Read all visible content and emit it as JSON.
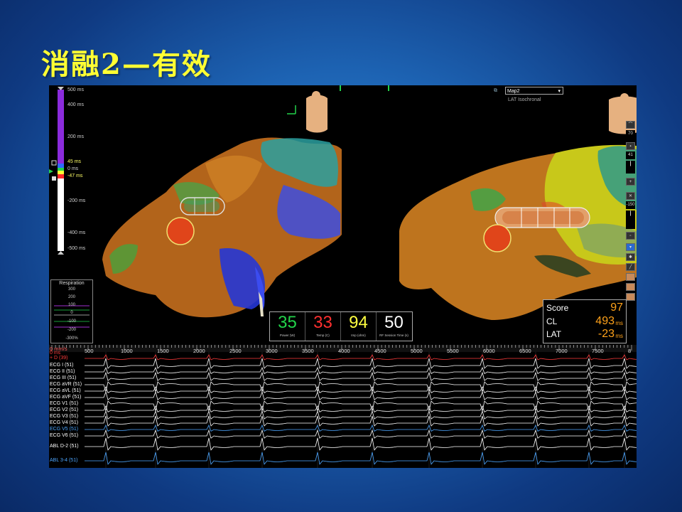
{
  "slide": {
    "title": "消融2—有效"
  },
  "color_scale": {
    "labels": [
      "500 ms",
      "400 ms",
      "200 ms",
      "45 ms",
      "0 ms",
      "-47 ms",
      "-200 ms",
      "-400 ms",
      "-500 ms"
    ],
    "colors": {
      "late": "#8b2bdc",
      "mid": "#2f6bff",
      "early": "#ff2b2b",
      "neutral": "#ffffff"
    }
  },
  "respiration": {
    "title": "Respiration",
    "labels": [
      "300",
      "200",
      "100",
      "0",
      "-100",
      "-200",
      "-300%"
    ]
  },
  "rf_panel": {
    "power": {
      "value": "35",
      "label": "Power (W)",
      "color": "#22d24a"
    },
    "temp": {
      "value": "33",
      "label": "Temp (C)",
      "color": "#ff3030"
    },
    "imp": {
      "value": "94",
      "label": "Imp (ohm)",
      "color": "#ffff40"
    },
    "session": {
      "value": "50",
      "label": "RF Session Time (s)",
      "color": "#ffffff"
    }
  },
  "map_selector": {
    "value": "Map2",
    "subtitle": "LAT Isochronal"
  },
  "stats": {
    "score": {
      "label": "Score",
      "value": "97"
    },
    "cl": {
      "label": "CL",
      "value": "493",
      "unit": "ms"
    },
    "lat": {
      "label": "LAT",
      "value": "-23",
      "unit": "ms"
    }
  },
  "side_tools": {
    "values": [
      "70",
      "41",
      "-150"
    ]
  },
  "ecg": {
    "time_start": "0 mm/s",
    "ticks": [
      "500",
      "1000",
      "1500",
      "2000",
      "2500",
      "3000",
      "3500",
      "4000",
      "4500",
      "5000",
      "5500",
      "6000",
      "6500",
      "7000",
      "7500",
      "8"
    ],
    "channels": [
      {
        "label": "0 ms",
        "color": "#ff3b3b"
      },
      {
        "label": "+ D (39)",
        "color": "#ff3b3b"
      },
      {
        "label": "ECG I (51)",
        "color": "#ffffff"
      },
      {
        "label": "ECG II (51)",
        "color": "#ffffff"
      },
      {
        "label": "ECG III (51)",
        "color": "#ffffff"
      },
      {
        "label": "ECG aVR (51)",
        "color": "#ffffff"
      },
      {
        "label": "ECG aVL (51)",
        "color": "#ffffff"
      },
      {
        "label": "ECG aVF (51)",
        "color": "#ffffff"
      },
      {
        "label": "ECG V1 (51)",
        "color": "#ffffff"
      },
      {
        "label": "ECG V2 (51)",
        "color": "#ffffff"
      },
      {
        "label": "ECG V3 (51)",
        "color": "#ffffff"
      },
      {
        "label": "ECG V4 (51)",
        "color": "#ffffff"
      },
      {
        "label": "ECG V5 (51)",
        "color": "#4da6ff"
      },
      {
        "label": "ECG V6 (51)",
        "color": "#ffffff"
      },
      {
        "label": "ABL  D-2 (51)",
        "color": "#ffffff"
      },
      {
        "label": "ABL  3-4 (51)",
        "color": "#4da6ff"
      }
    ]
  }
}
